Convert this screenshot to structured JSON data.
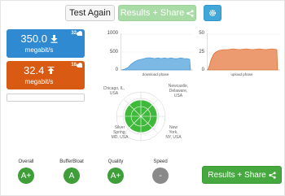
{
  "toolbar": {
    "test_again_label": "Test Again",
    "share_label": "Results + Share"
  },
  "download": {
    "value": "350.0",
    "unit": "megabit/s",
    "count": "32",
    "color": "#2f8ad2"
  },
  "upload": {
    "value": "32.4",
    "unit": "megabit/s",
    "count": "16",
    "color": "#d95a12"
  },
  "download_chart": {
    "y_max": "1000",
    "y_mid": "500",
    "y_min": "0",
    "phase_label": "download phase"
  },
  "upload_chart": {
    "y_max": "50",
    "y_mid": "25",
    "y_min": "0",
    "phase_label": "upload phase"
  },
  "servers": [
    "Chicago, IL, USA",
    "Newcastle, Delaware, USA",
    "Silver Spring, MD, USA",
    "New York, NY, USA"
  ],
  "grades": [
    {
      "label": "Overall",
      "grade": "A+",
      "color": "#3f9e3a"
    },
    {
      "label": "BufferBloat",
      "grade": "A",
      "color": "#3f9e3a"
    },
    {
      "label": "Quality",
      "grade": "A+",
      "color": "#3f9e3a"
    },
    {
      "label": "Speed",
      "grade": "-",
      "color": "#8a8a8a"
    }
  ],
  "bottom": {
    "share_label": "Results + Share"
  },
  "icons": {
    "download": "download-arrow-icon",
    "upload": "upload-arrow-icon",
    "cloud": "cloud-icon",
    "share": "share-icon",
    "gear": "gear-icon"
  }
}
